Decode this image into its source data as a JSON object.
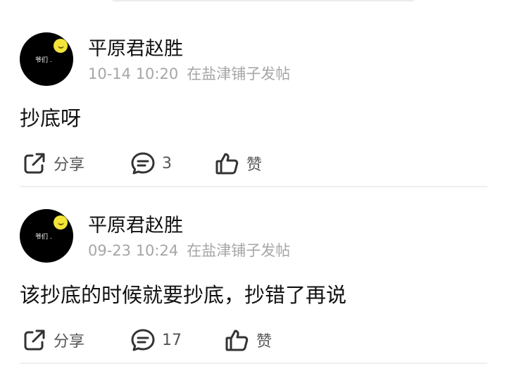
{
  "posts": [
    {
      "username": "平原君赵胜",
      "avatar_text": "爷们 .",
      "date": "10-14 10:20",
      "location": "在盐津铺子发帖",
      "content": "抄底呀",
      "share_label": "分享",
      "comment_count": "3",
      "like_label": "赞"
    },
    {
      "username": "平原君赵胜",
      "avatar_text": "爷们 .",
      "date": "09-23 10:24",
      "location": "在盐津铺子发帖",
      "content": "该抄底的时候就要抄底，抄错了再说",
      "share_label": "分享",
      "comment_count": "17",
      "like_label": "赞"
    }
  ],
  "icons": {
    "share": "share-icon",
    "comment": "comment-icon",
    "like": "thumbs-up-icon"
  },
  "colors": {
    "meta_text": "#a6a6a6",
    "action_text": "#555555",
    "divider": "#efefef"
  }
}
